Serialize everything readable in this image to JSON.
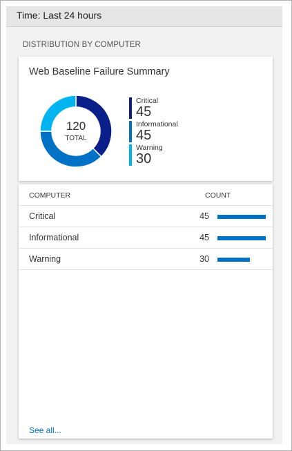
{
  "header": {
    "time_label": "Time: Last 24 hours"
  },
  "section": {
    "title": "DISTRIBUTION BY COMPUTER"
  },
  "summary_tile": {
    "title": "Web Baseline Failure Summary",
    "total_value": "120",
    "total_label": "TOTAL",
    "legend": [
      {
        "name": "Critical",
        "value": "45",
        "color": "#0b1f8a"
      },
      {
        "name": "Informational",
        "value": "45",
        "color": "#0072c6"
      },
      {
        "name": "Warning",
        "value": "30",
        "color": "#00b4f0"
      }
    ]
  },
  "table": {
    "columns": {
      "computer": "COMPUTER",
      "count": "COUNT"
    },
    "rows": [
      {
        "name": "Critical",
        "count": "45",
        "fraction": 1.0
      },
      {
        "name": "Informational",
        "count": "45",
        "fraction": 1.0
      },
      {
        "name": "Warning",
        "count": "30",
        "fraction": 0.667
      }
    ],
    "see_all": "See all..."
  },
  "chart_data": {
    "type": "pie",
    "categories": [
      "Critical",
      "Informational",
      "Warning"
    ],
    "values": [
      45,
      45,
      30
    ],
    "colors": [
      "#0b1f8a",
      "#0072c6",
      "#00b4f0"
    ],
    "title": "Web Baseline Failure Summary"
  }
}
